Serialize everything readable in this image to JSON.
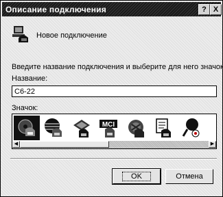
{
  "window": {
    "title": "Описание подключения",
    "help_glyph": "?",
    "close_glyph": "X"
  },
  "connection": {
    "name_text": "Новое подключение",
    "icon": "phone-computer-icon"
  },
  "prompt_text": "Введите название подключения и выберите для него значок:",
  "name_field": {
    "label": "Название:",
    "value": "C6-22"
  },
  "icon_picker": {
    "label": "Значок:",
    "icons": [
      {
        "name": "disk-phone-icon",
        "selected": true
      },
      {
        "name": "globe-phone-icon",
        "selected": false
      },
      {
        "name": "modem-phone-icon",
        "selected": false
      },
      {
        "name": "mci-phone-icon",
        "text": "MCI",
        "selected": false
      },
      {
        "name": "network-phone-icon",
        "selected": false
      },
      {
        "name": "document-phone-icon",
        "selected": false
      },
      {
        "name": "satellite-phone-icon",
        "selected": false
      }
    ]
  },
  "buttons": {
    "ok_label": "OK",
    "cancel_label": "Отмена"
  }
}
